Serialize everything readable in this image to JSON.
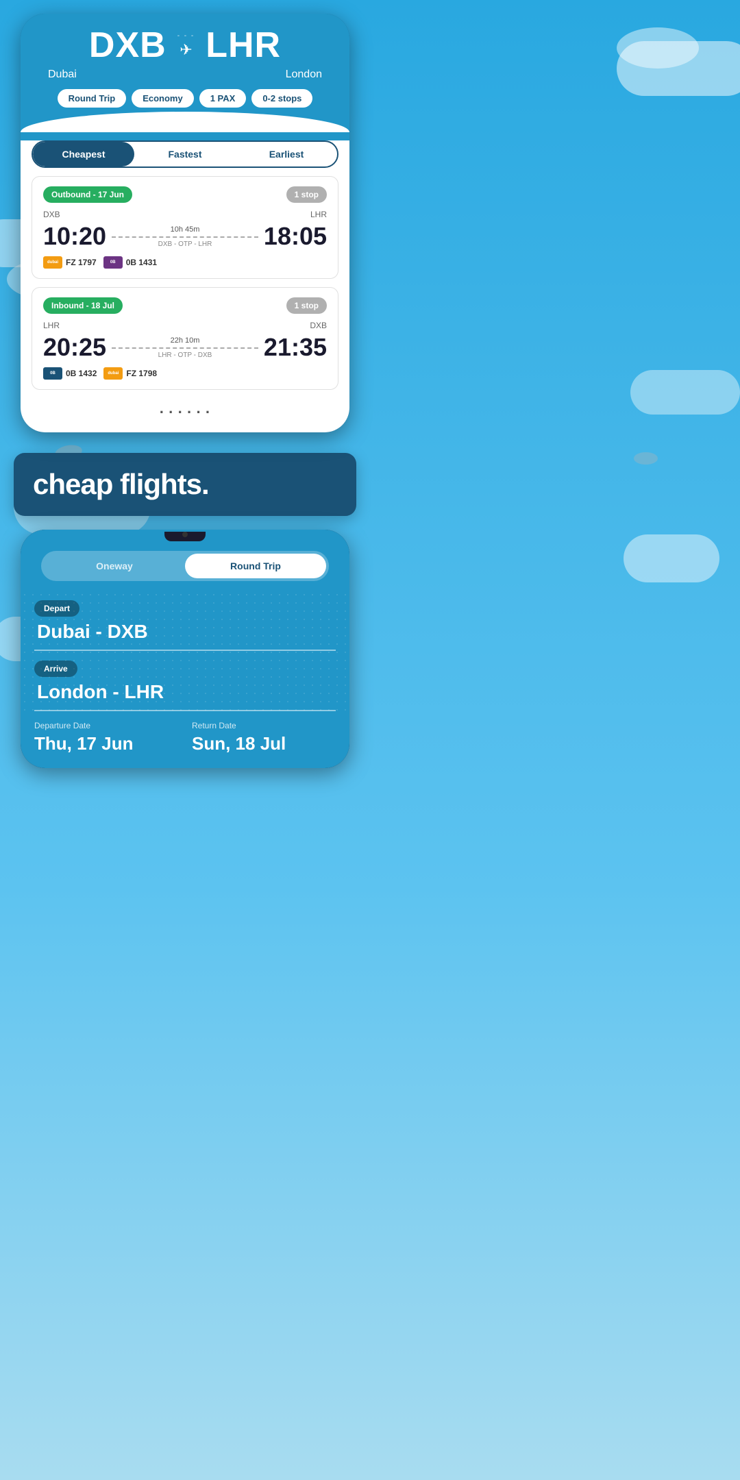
{
  "topPhone": {
    "origin": {
      "code": "DXB",
      "city": "Dubai"
    },
    "destination": {
      "code": "LHR",
      "city": "London"
    },
    "filters": {
      "tripType": "Round Trip",
      "cabin": "Economy",
      "pax": "1 PAX",
      "stops": "0-2 stops"
    },
    "tabs": [
      {
        "label": "Cheapest",
        "active": true
      },
      {
        "label": "Fastest",
        "active": false
      },
      {
        "label": "Earliest",
        "active": false
      }
    ],
    "outbound": {
      "badge": "Outbound - 17 Jun",
      "stopBadge": "1 stop",
      "from": "DXB",
      "to": "LHR",
      "depTime": "10:20",
      "arrTime": "18:05",
      "duration": "10h 45m",
      "route": "DXB - OTP - LHR",
      "airlines": [
        {
          "color": "orange",
          "code": "FZ 1797",
          "label": "dubai"
        },
        {
          "color": "purple",
          "code": "0B 1431",
          "label": "0B"
        }
      ]
    },
    "inbound": {
      "badge": "Inbound - 18 Jul",
      "stopBadge": "1 stop",
      "from": "LHR",
      "to": "DXB",
      "depTime": "20:25",
      "arrTime": "21:35",
      "duration": "22h 10m",
      "route": "LHR - OTP - DXB",
      "airlines": [
        {
          "color": "blue",
          "code": "0B 1432",
          "label": "0B"
        },
        {
          "color": "orange",
          "code": "FZ 1798",
          "label": "dubai"
        }
      ]
    }
  },
  "banner": {
    "text": "cheap flights."
  },
  "bottomPhone": {
    "toggle": {
      "oneway": "Oneway",
      "roundTrip": "Round Trip",
      "activeTab": "roundTrip"
    },
    "depart": {
      "label": "Depart",
      "value": "Dubai - DXB"
    },
    "arrive": {
      "label": "Arrive",
      "value": "London - LHR"
    },
    "dates": {
      "departure": {
        "label": "Departure Date",
        "value": "Thu, 17 Jun"
      },
      "return": {
        "label": "Return Date",
        "value": "Sun, 18 Jul"
      }
    }
  }
}
